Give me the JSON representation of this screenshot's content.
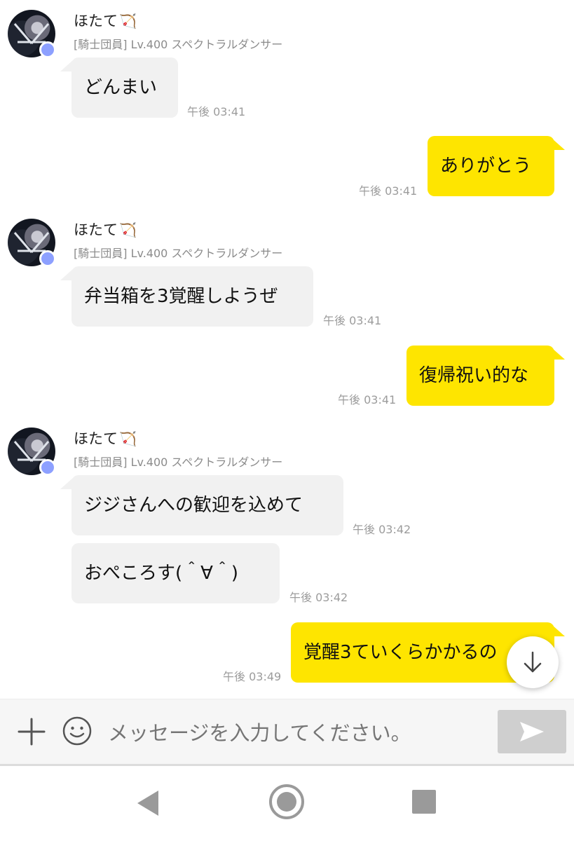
{
  "messages": [
    {
      "type": "incoming",
      "sender": "ほたて",
      "sender_icon": "bow-arrow-icon",
      "guild": "[騎士団員] Lv.400 スペクトラルダンサー",
      "text": "どんまい",
      "time": "午後 03:41"
    },
    {
      "type": "outgoing",
      "text": "ありがとう",
      "time": "午後 03:41"
    },
    {
      "type": "incoming",
      "sender": "ほたて",
      "sender_icon": "bow-arrow-icon",
      "guild": "[騎士団員] Lv.400 スペクトラルダンサー",
      "text": "弁当箱を3覚醒しようぜ",
      "time": "午後 03:41"
    },
    {
      "type": "outgoing",
      "text": "復帰祝い的な",
      "time": "午後 03:41"
    },
    {
      "type": "incoming",
      "sender": "ほたて",
      "sender_icon": "bow-arrow-icon",
      "guild": "[騎士団員] Lv.400 スペクトラルダンサー",
      "text": "ジジさんへの歓迎を込めて",
      "time": "午後 03:42"
    },
    {
      "type": "incoming-cont",
      "text": "おぺころす(＾∀＾)",
      "time": "午後 03:42"
    },
    {
      "type": "outgoing",
      "text": "覚醒3ていくらかかるの",
      "time": "午後 03:49"
    }
  ],
  "composer": {
    "placeholder": "メッセージを入力してください。"
  },
  "colors": {
    "outgoing_bubble": "#fee500",
    "incoming_bubble": "#f1f1f1",
    "status_dot": "#8da0ff"
  }
}
